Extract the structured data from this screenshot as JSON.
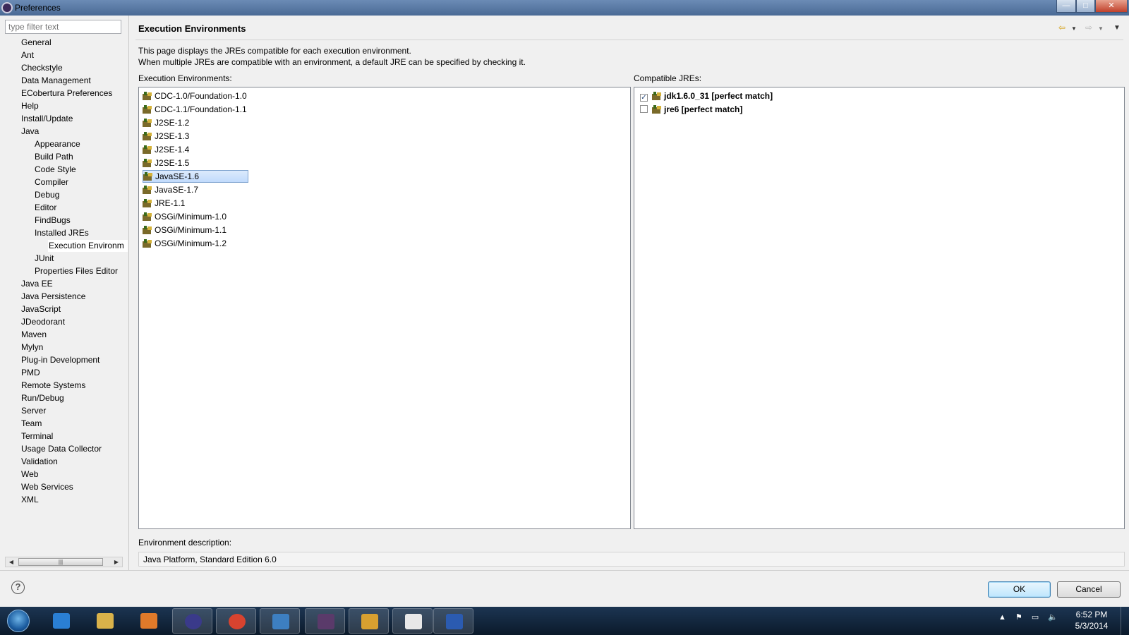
{
  "window": {
    "title": "Preferences"
  },
  "filter": {
    "placeholder": "type filter text"
  },
  "tree": {
    "items": [
      {
        "label": "General",
        "level": 0
      },
      {
        "label": "Ant",
        "level": 0
      },
      {
        "label": "Checkstyle",
        "level": 0
      },
      {
        "label": "Data Management",
        "level": 0
      },
      {
        "label": "ECobertura Preferences",
        "level": 0
      },
      {
        "label": "Help",
        "level": 0
      },
      {
        "label": "Install/Update",
        "level": 0
      },
      {
        "label": "Java",
        "level": 0
      },
      {
        "label": "Appearance",
        "level": 1
      },
      {
        "label": "Build Path",
        "level": 1
      },
      {
        "label": "Code Style",
        "level": 1
      },
      {
        "label": "Compiler",
        "level": 1
      },
      {
        "label": "Debug",
        "level": 1
      },
      {
        "label": "Editor",
        "level": 1
      },
      {
        "label": "FindBugs",
        "level": 1
      },
      {
        "label": "Installed JREs",
        "level": 1
      },
      {
        "label": "Execution Environm",
        "level": 2,
        "selected": true
      },
      {
        "label": "JUnit",
        "level": 1
      },
      {
        "label": "Properties Files Editor",
        "level": 1
      },
      {
        "label": "Java EE",
        "level": 0
      },
      {
        "label": "Java Persistence",
        "level": 0
      },
      {
        "label": "JavaScript",
        "level": 0
      },
      {
        "label": "JDeodorant",
        "level": 0
      },
      {
        "label": "Maven",
        "level": 0
      },
      {
        "label": "Mylyn",
        "level": 0
      },
      {
        "label": "Plug-in Development",
        "level": 0
      },
      {
        "label": "PMD",
        "level": 0
      },
      {
        "label": "Remote Systems",
        "level": 0
      },
      {
        "label": "Run/Debug",
        "level": 0
      },
      {
        "label": "Server",
        "level": 0
      },
      {
        "label": "Team",
        "level": 0
      },
      {
        "label": "Terminal",
        "level": 0
      },
      {
        "label": "Usage Data Collector",
        "level": 0
      },
      {
        "label": "Validation",
        "level": 0
      },
      {
        "label": "Web",
        "level": 0
      },
      {
        "label": "Web Services",
        "level": 0
      },
      {
        "label": "XML",
        "level": 0
      }
    ]
  },
  "page": {
    "title": "Execution Environments",
    "description_line1": "This page displays the JREs compatible for each execution environment.",
    "description_line2": "When multiple JREs are compatible with an environment, a default JRE can be specified by checking it.",
    "envs_label": "Execution Environments:",
    "jres_label": "Compatible JREs:",
    "env_desc_label": "Environment description:",
    "env_desc_value": "Java Platform, Standard Edition 6.0"
  },
  "environments": [
    {
      "label": "CDC-1.0/Foundation-1.0"
    },
    {
      "label": "CDC-1.1/Foundation-1.1"
    },
    {
      "label": "J2SE-1.2"
    },
    {
      "label": "J2SE-1.3"
    },
    {
      "label": "J2SE-1.4"
    },
    {
      "label": "J2SE-1.5"
    },
    {
      "label": "JavaSE-1.6",
      "selected": true
    },
    {
      "label": "JavaSE-1.7"
    },
    {
      "label": "JRE-1.1"
    },
    {
      "label": "OSGi/Minimum-1.0"
    },
    {
      "label": "OSGi/Minimum-1.1"
    },
    {
      "label": "OSGi/Minimum-1.2"
    }
  ],
  "jres": [
    {
      "label": "jdk1.6.0_31 [perfect match]",
      "checked": true
    },
    {
      "label": "jre6 [perfect match]",
      "checked": false
    }
  ],
  "buttons": {
    "ok": "OK",
    "cancel": "Cancel"
  },
  "icons": {
    "help": "question-mark-icon",
    "back": "back-arrow-icon",
    "forward": "forward-arrow-icon",
    "menu": "view-menu-icon"
  },
  "taskbar": {
    "apps": [
      "Internet Explorer",
      "Windows Explorer",
      "Windows Media Player",
      "Eclipse",
      "Google Chrome",
      "Lync",
      "Java EE IDE",
      "Outlook",
      "Notepad",
      "Word"
    ],
    "clock_time": "6:52 PM",
    "clock_date": "5/3/2014"
  }
}
